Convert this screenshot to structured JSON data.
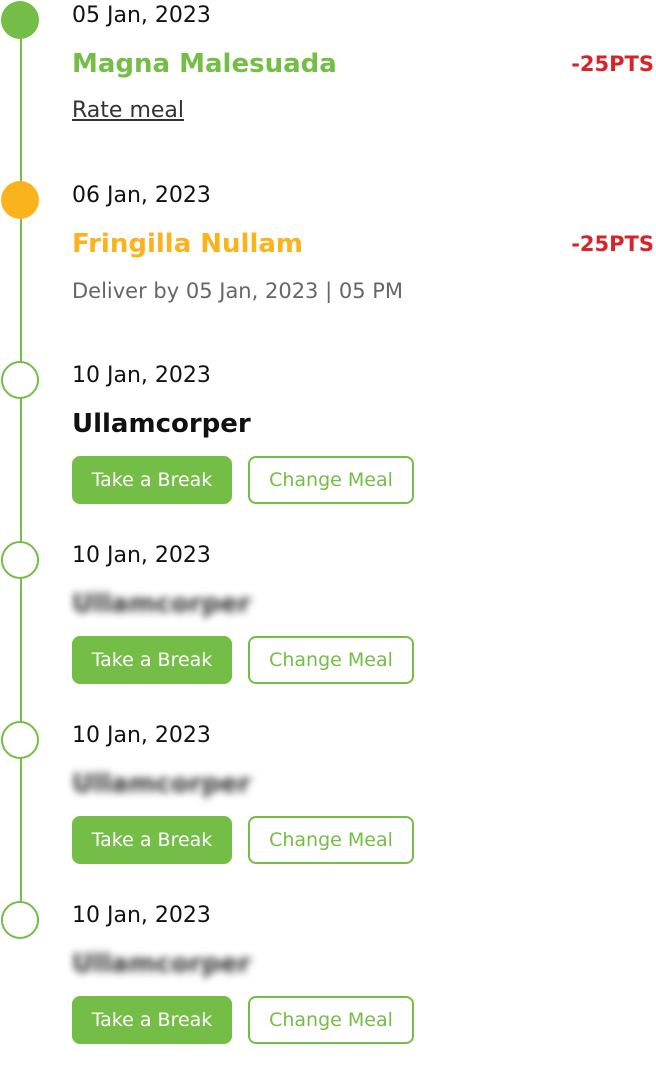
{
  "timeline": {
    "entries": [
      {
        "date": "05 Jan, 2023",
        "meal": "Magna Malesuada",
        "points": "-25PTS",
        "action_link": "Rate meal"
      },
      {
        "date": "06 Jan, 2023",
        "meal": "Fringilla Nullam",
        "points": "-25PTS",
        "delivery_note": "Deliver by 05 Jan, 2023 | 05 PM"
      },
      {
        "date": "10 Jan, 2023",
        "meal": "Ullamcorper",
        "buttons": {
          "break": "Take a Break",
          "change": "Change Meal"
        }
      },
      {
        "date": "10 Jan, 2023",
        "meal": "Ullamcorper",
        "buttons": {
          "break": "Take a Break",
          "change": "Change Meal"
        }
      },
      {
        "date": "10 Jan, 2023",
        "meal": "Ullamcorper",
        "buttons": {
          "break": "Take a Break",
          "change": "Change Meal"
        }
      },
      {
        "date": "10 Jan, 2023",
        "meal": "Ullamcorper",
        "buttons": {
          "break": "Take a Break",
          "change": "Change Meal"
        }
      }
    ]
  },
  "colors": {
    "accent_green": "#74bd46",
    "accent_orange": "#fbb31d",
    "points_red": "#d7242b"
  }
}
